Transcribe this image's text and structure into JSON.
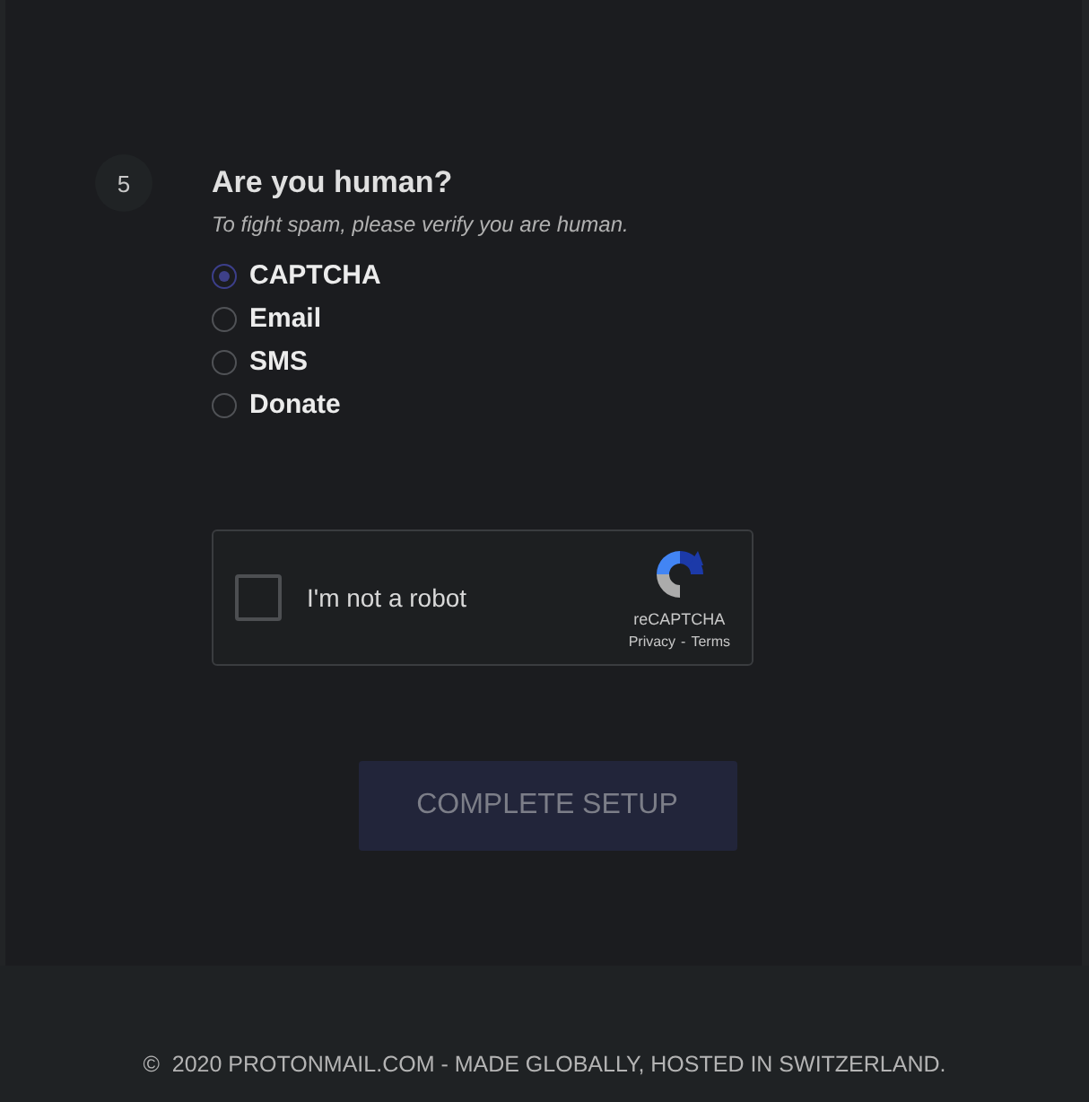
{
  "step": {
    "number": "5",
    "title": "Are you human?",
    "subtitle": "To fight spam, please verify you are human."
  },
  "methods": [
    {
      "label": "CAPTCHA",
      "selected": true
    },
    {
      "label": "Email",
      "selected": false
    },
    {
      "label": "SMS",
      "selected": false
    },
    {
      "label": "Donate",
      "selected": false
    }
  ],
  "recaptcha": {
    "label": "I'm not a robot",
    "checked": false,
    "brand": "reCAPTCHA",
    "privacy": "Privacy",
    "separator": "-",
    "terms": "Terms"
  },
  "submit": {
    "label": "COMPLETE SETUP",
    "disabled": true
  },
  "footer": "©  2020 PROTONMAIL.COM - MADE GLOBALLY, HOSTED IN SWITZERLAND."
}
